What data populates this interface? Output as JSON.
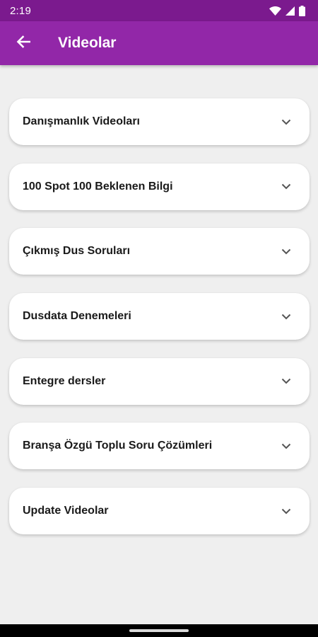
{
  "status_bar": {
    "time": "2:19",
    "icons": [
      "wifi-icon",
      "signal-icon",
      "battery-icon"
    ]
  },
  "app_bar": {
    "title": "Videolar",
    "back_icon": "arrow-left-icon",
    "color": "#9227a8",
    "status_color": "#7b1a8e"
  },
  "items": [
    {
      "label": "Danışmanlık Videoları",
      "icon": "chevron-down-icon"
    },
    {
      "label": "100 Spot 100 Beklenen Bilgi",
      "icon": "chevron-down-icon"
    },
    {
      "label": "Çıkmış Dus Soruları",
      "icon": "chevron-down-icon"
    },
    {
      "label": "Dusdata Denemeleri",
      "icon": "chevron-down-icon"
    },
    {
      "label": "Entegre dersler",
      "icon": "chevron-down-icon"
    },
    {
      "label": "Branşa Özgü Toplu Soru Çözümleri",
      "icon": "chevron-down-icon"
    },
    {
      "label": "Update Videolar",
      "icon": "chevron-down-icon"
    }
  ]
}
